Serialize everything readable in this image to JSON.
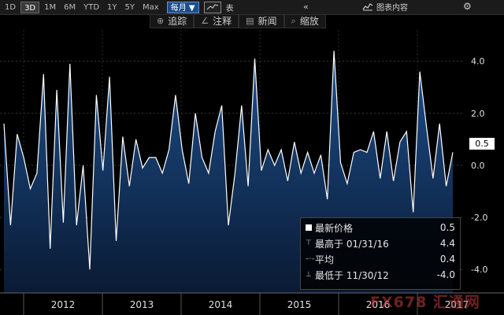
{
  "toolbar": {
    "ranges": [
      "1D",
      "3D",
      "1M",
      "6M",
      "YTD",
      "1Y",
      "5Y",
      "Max"
    ],
    "active_range": "3D",
    "frequency": "每月",
    "table_label": "表",
    "chart_content_label": "图表内容"
  },
  "tools": [
    {
      "icon": "⊕",
      "label": "追踪"
    },
    {
      "icon": "∠",
      "label": "注释"
    },
    {
      "icon": "▤",
      "label": "新闻"
    },
    {
      "icon": "⌕",
      "label": "缩放"
    }
  ],
  "price_tag": "0.5",
  "legend": {
    "last_label": "最新价格",
    "last_value": "0.5",
    "high_label": "最高于 01/31/16",
    "high_value": "4.4",
    "avg_label": "平均",
    "avg_value": "0.4",
    "low_label": "最低于 11/30/12",
    "low_value": "-4.0"
  },
  "watermark": "FX678 汇通网",
  "colors": {
    "line": "#ffffff",
    "area_top": "#1d4f8c",
    "area_bottom": "#0a1a33",
    "background": "#000000"
  },
  "chart_data": {
    "type": "area",
    "x_labels": [
      "2012",
      "2013",
      "2014",
      "2015",
      "2016",
      "2017"
    ],
    "y_ticks": [
      4.0,
      2.0,
      0.0,
      -2.0,
      -4.0
    ],
    "ylim": [
      -4.9,
      5.2
    ],
    "grid": true,
    "legend_position": "bottom-right",
    "values": [
      1.6,
      -2.3,
      1.2,
      0.3,
      -0.9,
      -0.3,
      3.5,
      -3.2,
      2.9,
      -2.2,
      3.9,
      -2.3,
      0.0,
      -4.0,
      2.7,
      -0.2,
      3.4,
      -2.9,
      1.1,
      -0.8,
      1.0,
      -0.1,
      0.3,
      0.3,
      -0.3,
      0.6,
      2.7,
      0.6,
      -0.7,
      2.0,
      0.3,
      -0.3,
      1.3,
      2.3,
      -2.3,
      -0.3,
      2.3,
      -0.8,
      4.1,
      -0.2,
      0.6,
      0.0,
      0.6,
      -0.6,
      0.9,
      -0.3,
      0.5,
      -0.3,
      0.4,
      -1.3,
      4.4,
      0.1,
      -0.7,
      0.5,
      0.6,
      0.5,
      1.3,
      -0.5,
      1.3,
      -0.6,
      0.9,
      1.3,
      -1.8,
      3.6,
      1.5,
      -0.5,
      1.6,
      -0.8,
      0.5
    ]
  }
}
